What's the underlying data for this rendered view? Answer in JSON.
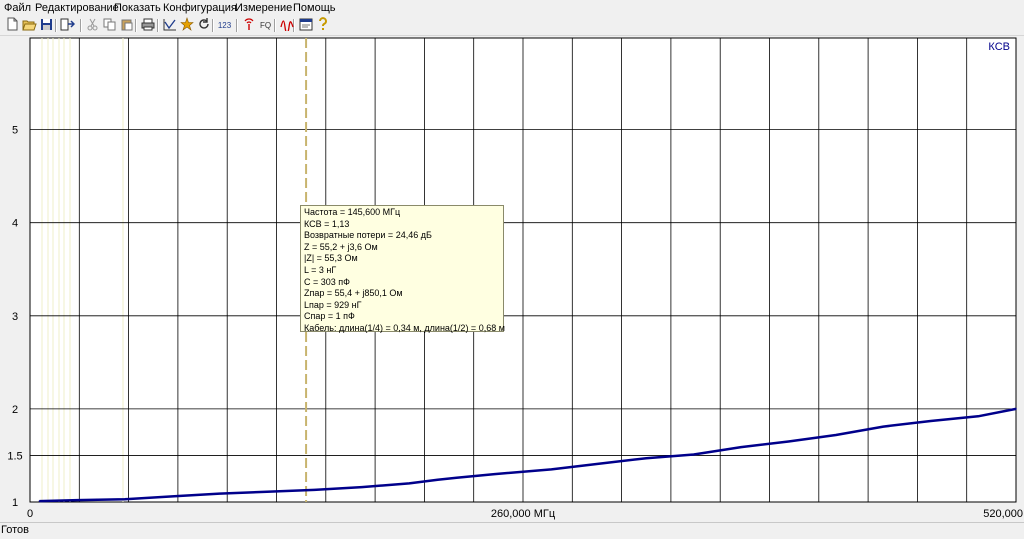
{
  "menu": [
    "Файл",
    "Редактирование",
    "Показать",
    "Конфигурация",
    "Измерение",
    "Помощь"
  ],
  "toolbar": {
    "buttons": [
      {
        "name": "new-file-icon"
      },
      {
        "name": "open-folder-icon"
      },
      {
        "name": "save-icon"
      },
      {
        "name": "export-icon"
      },
      {
        "name": "cut-icon"
      },
      {
        "name": "copy-icon"
      },
      {
        "name": "paste-icon"
      },
      {
        "name": "print-icon"
      },
      {
        "name": "graph-icon"
      },
      {
        "name": "star-icon"
      },
      {
        "name": "refresh-icon"
      },
      {
        "name": "numbers-icon",
        "text": "123"
      },
      {
        "name": "antenna-icon"
      },
      {
        "name": "frequency-icon",
        "text": "FQ"
      },
      {
        "name": "wave-icon"
      },
      {
        "name": "dialog-icon"
      },
      {
        "name": "help-icon"
      }
    ]
  },
  "status": {
    "text": "Готов"
  },
  "colors": {
    "plot_bg": "#ffffff",
    "grid": "#000000",
    "trace": "#00008b",
    "marker": "#c8b46e",
    "tooltip_bg": "#ffffe1"
  },
  "tooltip": {
    "lines": [
      "Частота = 145,600 МГц",
      "КСВ = 1,13",
      "Возвратные потери = 24,46 дБ",
      "Z = 55,2 + j3,6 Ом",
      "|Z| = 55,3 Ом",
      "L = 3 нГ",
      "C = 303 пФ",
      "Zпар = 55,4 + j850,1 Ом",
      "Lпар = 929 нГ",
      "Cпар = 1 пФ",
      "Кабель: длина(1/4) = 0,34 м, длина(1/2) = 0,68 м"
    ]
  },
  "chart_data": {
    "type": "line",
    "legend": "КСВ",
    "legend_position": "top-right",
    "grid": true,
    "xlim": [
      0,
      520
    ],
    "x_ticks": [
      0,
      260,
      520
    ],
    "x_tick_labels": [
      "0",
      "260,000 МГц",
      "520,000"
    ],
    "ylim": [
      1,
      6
    ],
    "y_ticks": [
      1,
      1.5,
      2,
      3,
      4,
      5
    ],
    "y_tick_labels": [
      "1",
      "1.5",
      "2",
      "3",
      "4",
      "5"
    ],
    "marker_x": 145.6,
    "series": [
      {
        "name": "КСВ",
        "x": [
          5,
          25,
          50,
          75,
          100,
          125,
          150,
          175,
          200,
          215,
          225,
          245,
          275,
          300,
          325,
          350,
          375,
          400,
          425,
          450,
          475,
          500,
          520
        ],
        "y": [
          1.01,
          1.02,
          1.03,
          1.06,
          1.09,
          1.11,
          1.13,
          1.16,
          1.2,
          1.24,
          1.26,
          1.3,
          1.35,
          1.41,
          1.47,
          1.51,
          1.59,
          1.65,
          1.72,
          1.81,
          1.87,
          1.92,
          2.0
        ]
      }
    ]
  }
}
